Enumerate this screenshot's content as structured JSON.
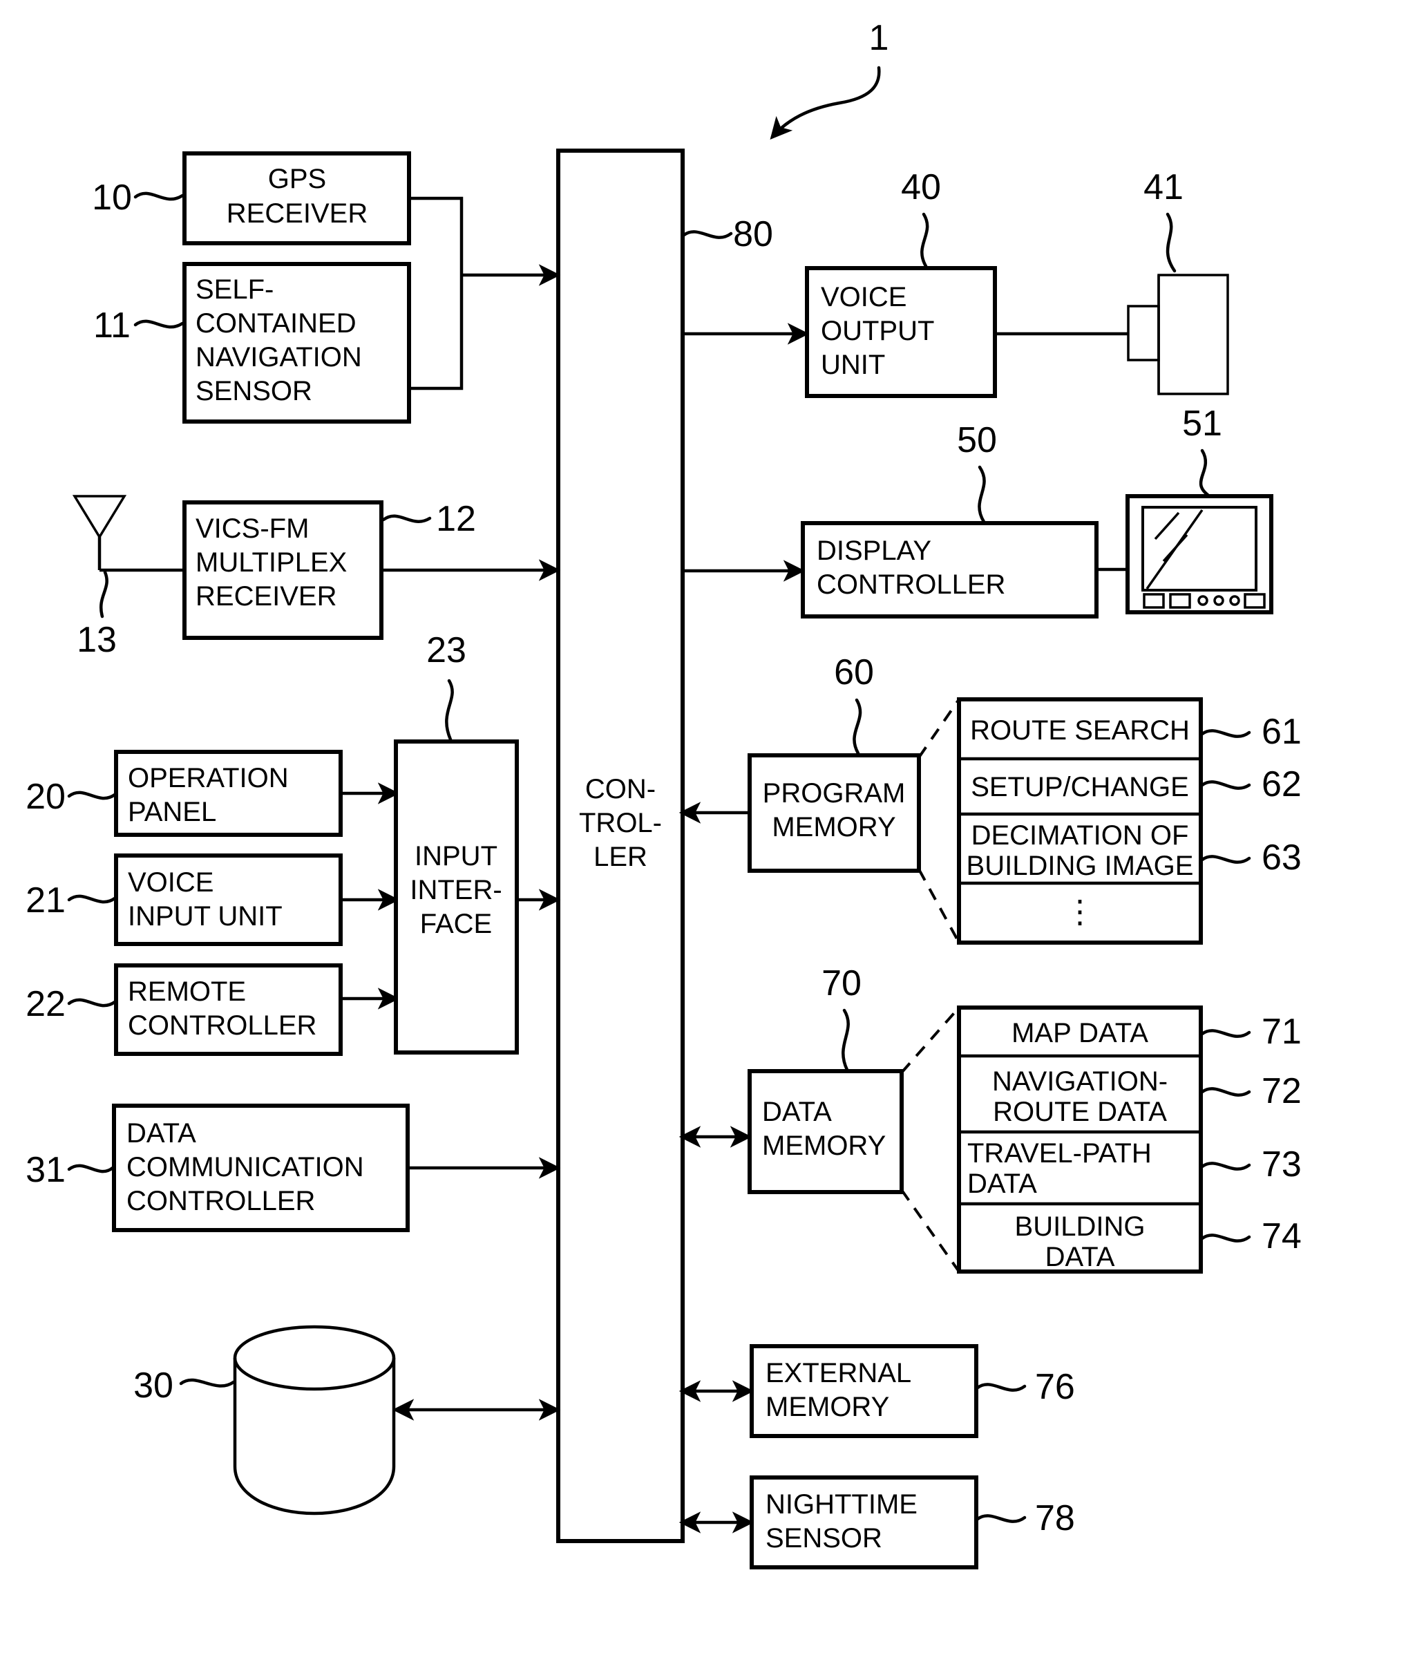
{
  "figure": {
    "system_label": "1"
  },
  "blocks": {
    "gps_receiver": {
      "ref": "10",
      "lines": [
        "GPS",
        "RECEIVER"
      ]
    },
    "self_contained": {
      "ref": "11",
      "lines": [
        "SELF-",
        "CONTAINED",
        "NAVIGATION",
        "SENSOR"
      ]
    },
    "vics_receiver": {
      "ref": "12",
      "lines": [
        "VICS-FM",
        "MULTIPLEX",
        "RECEIVER"
      ]
    },
    "antenna": {
      "ref": "13",
      "lines": []
    },
    "operation_panel": {
      "ref": "20",
      "lines": [
        "OPERATION",
        "PANEL"
      ]
    },
    "voice_input_unit": {
      "ref": "21",
      "lines": [
        "VOICE",
        "INPUT UNIT"
      ]
    },
    "remote_controller": {
      "ref": "22",
      "lines": [
        "REMOTE",
        "CONTROLLER"
      ]
    },
    "input_interface": {
      "ref": "23",
      "lines": [
        "INPUT",
        "INTER-",
        "FACE"
      ]
    },
    "storage_disk": {
      "ref": "30",
      "lines": []
    },
    "data_comm_controller": {
      "ref": "31",
      "lines": [
        "DATA",
        "COMMUNICATION",
        "CONTROLLER"
      ]
    },
    "voice_output_unit": {
      "ref": "40",
      "lines": [
        "VOICE",
        "OUTPUT",
        "UNIT"
      ]
    },
    "speaker": {
      "ref": "41",
      "lines": []
    },
    "display_controller": {
      "ref": "50",
      "lines": [
        "DISPLAY",
        "CONTROLLER"
      ]
    },
    "monitor": {
      "ref": "51",
      "lines": []
    },
    "program_memory": {
      "ref": "60",
      "lines": [
        "PROGRAM",
        "MEMORY"
      ]
    },
    "route_search": {
      "ref": "61",
      "lines": [
        "ROUTE SEARCH"
      ]
    },
    "setup_change": {
      "ref": "62",
      "lines": [
        "SETUP/CHANGE"
      ]
    },
    "decimation": {
      "ref": "63",
      "lines": [
        "DECIMATION OF",
        "BUILDING IMAGE"
      ]
    },
    "program_more": {
      "ref": "",
      "lines": [
        "⋮"
      ]
    },
    "data_memory": {
      "ref": "70",
      "lines": [
        "DATA",
        "MEMORY"
      ]
    },
    "map_data": {
      "ref": "71",
      "lines": [
        "MAP DATA"
      ]
    },
    "nav_route_data": {
      "ref": "72",
      "lines": [
        "NAVIGATION-",
        "ROUTE DATA"
      ]
    },
    "travel_path_data": {
      "ref": "73",
      "lines": [
        "TRAVEL-PATH",
        "DATA"
      ]
    },
    "building_data": {
      "ref": "74",
      "lines": [
        "BUILDING",
        "DATA"
      ]
    },
    "external_memory": {
      "ref": "76",
      "lines": [
        "EXTERNAL",
        "MEMORY"
      ]
    },
    "nighttime_sensor": {
      "ref": "78",
      "lines": [
        "NIGHTTIME",
        "SENSOR"
      ]
    },
    "controller": {
      "ref": "80",
      "lines": [
        "CON-",
        "TROL-",
        "LER"
      ]
    }
  },
  "text": {
    "gps_l1": "GPS",
    "gps_l2": "RECEIVER",
    "self_l1": "SELF-",
    "self_l2": "CONTAINED",
    "self_l3": "NAVIGATION",
    "self_l4": "SENSOR",
    "vics_l1": "VICS-FM",
    "vics_l2": "MULTIPLEX",
    "vics_l3": "RECEIVER",
    "op_l1": "OPERATION",
    "op_l2": "PANEL",
    "vin_l1": "VOICE",
    "vin_l2": "INPUT UNIT",
    "rc_l1": "REMOTE",
    "rc_l2": "CONTROLLER",
    "ii_l1": "INPUT",
    "ii_l2": "INTER-",
    "ii_l3": "FACE",
    "dcc_l1": "DATA",
    "dcc_l2": "COMMUNICATION",
    "dcc_l3": "CONTROLLER",
    "vout_l1": "VOICE",
    "vout_l2": "OUTPUT",
    "vout_l3": "UNIT",
    "disp_l1": "DISPLAY",
    "disp_l2": "CONTROLLER",
    "pm_l1": "PROGRAM",
    "pm_l2": "MEMORY",
    "rs_l1": "ROUTE SEARCH",
    "sc_l1": "SETUP/CHANGE",
    "dec_l1": "DECIMATION OF",
    "dec_l2": "BUILDING IMAGE",
    "vdots": "⋮",
    "dm_l1": "DATA",
    "dm_l2": "MEMORY",
    "md_l1": "MAP DATA",
    "nrd_l1": "NAVIGATION-",
    "nrd_l2": "ROUTE DATA",
    "tpd_l1": "TRAVEL-PATH",
    "tpd_l2": "DATA",
    "bd_l1": "BUILDING",
    "bd_l2": "DATA",
    "em_l1": "EXTERNAL",
    "em_l2": "MEMORY",
    "ns_l1": "NIGHTTIME",
    "ns_l2": "SENSOR",
    "ctrl_l1": "CON-",
    "ctrl_l2": "TROL-",
    "ctrl_l3": "LER"
  },
  "refs": {
    "n1": "1",
    "n10": "10",
    "n11": "11",
    "n12": "12",
    "n13": "13",
    "n20": "20",
    "n21": "21",
    "n22": "22",
    "n23": "23",
    "n30": "30",
    "n31": "31",
    "n40": "40",
    "n41": "41",
    "n50": "50",
    "n51": "51",
    "n60": "60",
    "n61": "61",
    "n62": "62",
    "n63": "63",
    "n70": "70",
    "n71": "71",
    "n72": "72",
    "n73": "73",
    "n74": "74",
    "n76": "76",
    "n78": "78",
    "n80": "80"
  },
  "colors": {
    "ink": "#000000",
    "paper": "#ffffff"
  }
}
